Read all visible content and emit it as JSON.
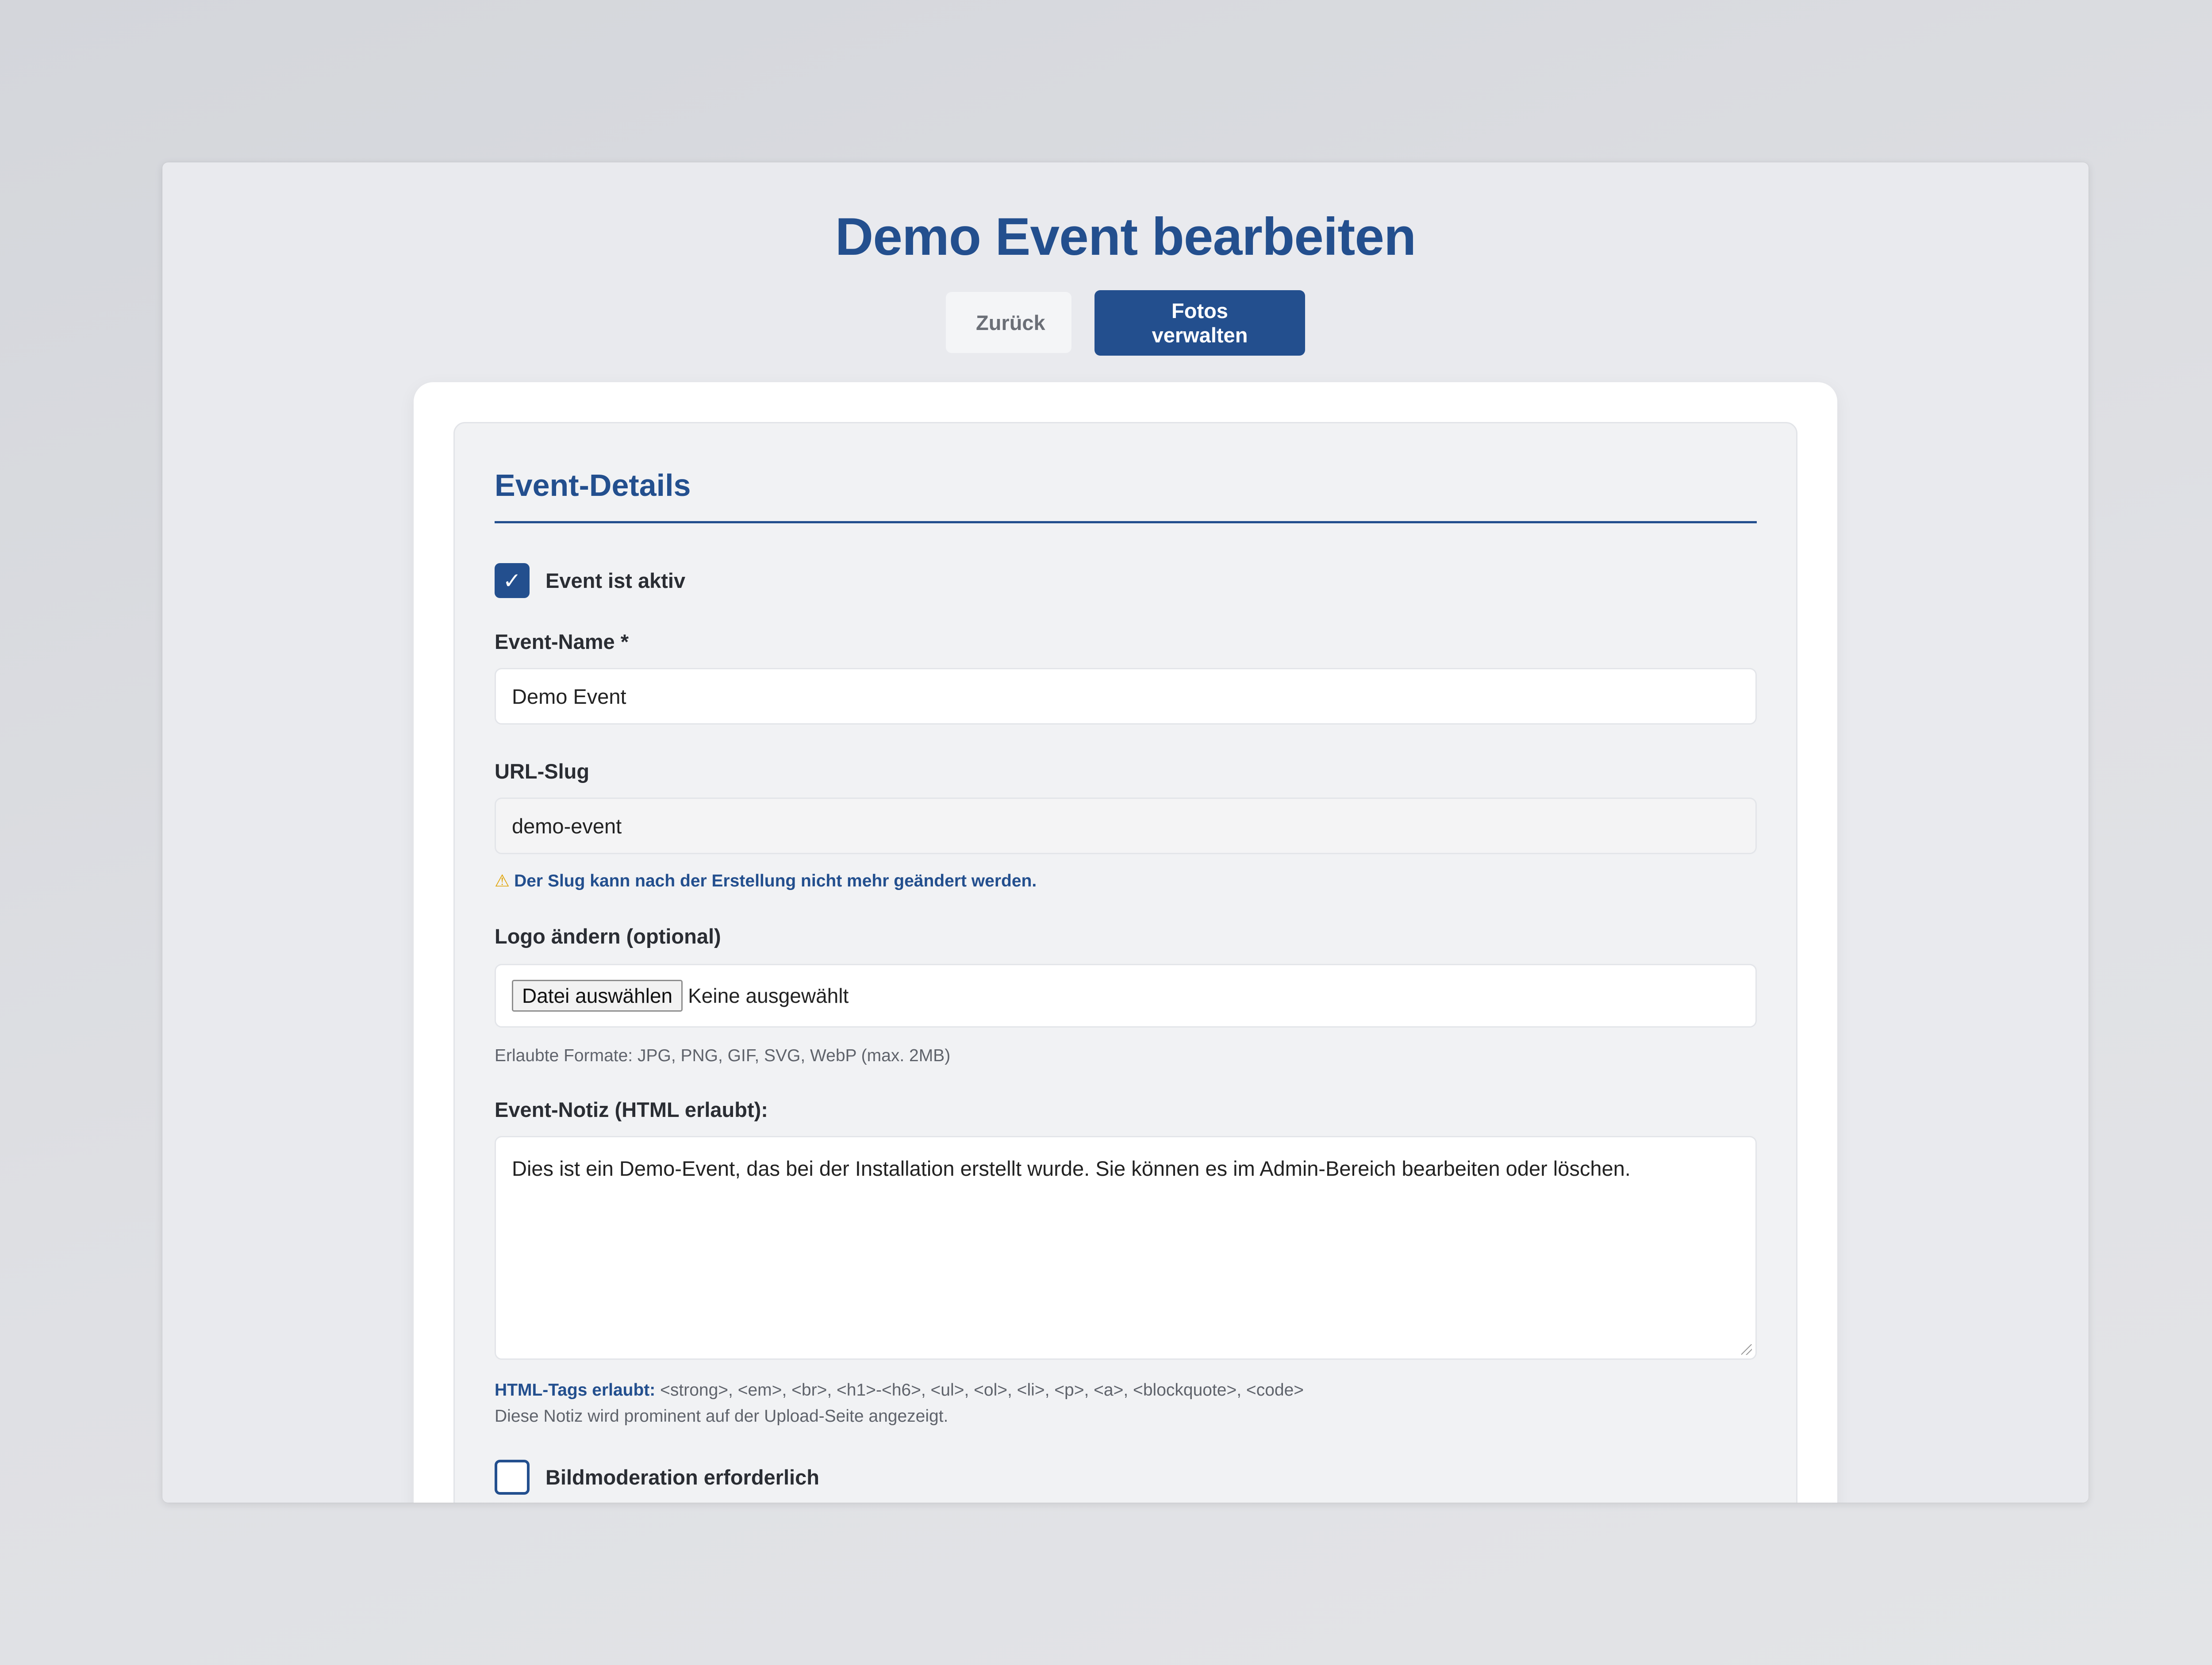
{
  "page": {
    "title": "Demo Event bearbeiten",
    "back_label": "Zurück",
    "photos_label": "Fotos verwalten"
  },
  "section": {
    "title": "Event-Details"
  },
  "form": {
    "active": {
      "label": "Event ist aktiv",
      "checked": true,
      "check_glyph": "✓"
    },
    "name": {
      "label": "Event-Name *",
      "value": "Demo Event"
    },
    "slug": {
      "label": "URL-Slug",
      "value": "demo-event",
      "warning_icon": "⚠",
      "warning": "Der Slug kann nach der Erstellung nicht mehr geändert werden."
    },
    "logo": {
      "label": "Logo ändern (optional)",
      "button_label": "Datei auswählen",
      "status": "Keine ausgewählt",
      "hint": "Erlaubte Formate: JPG, PNG, GIF, SVG, WebP (max. 2MB)"
    },
    "note": {
      "label": "Event-Notiz (HTML erlaubt):",
      "value": "Dies ist ein Demo-Event, das bei der Installation erstellt wurde. Sie können es im Admin-Bereich bearbeiten oder löschen.",
      "tags_label": "HTML-Tags erlaubt:",
      "tags": " <strong>, <em>, <br>, <h1>-<h6>, <ul>, <ol>, <li>, <p>, <a>, <blockquote>, <code>",
      "hint": "Diese Notiz wird prominent auf der Upload-Seite angezeigt."
    },
    "moderation": {
      "label": "Bildmoderation erforderlich",
      "checked": false
    }
  },
  "colors": {
    "primary": "#234f8e",
    "warning": "#e0a100",
    "panel": "#f1f2f4",
    "background": "#e9eaee"
  }
}
